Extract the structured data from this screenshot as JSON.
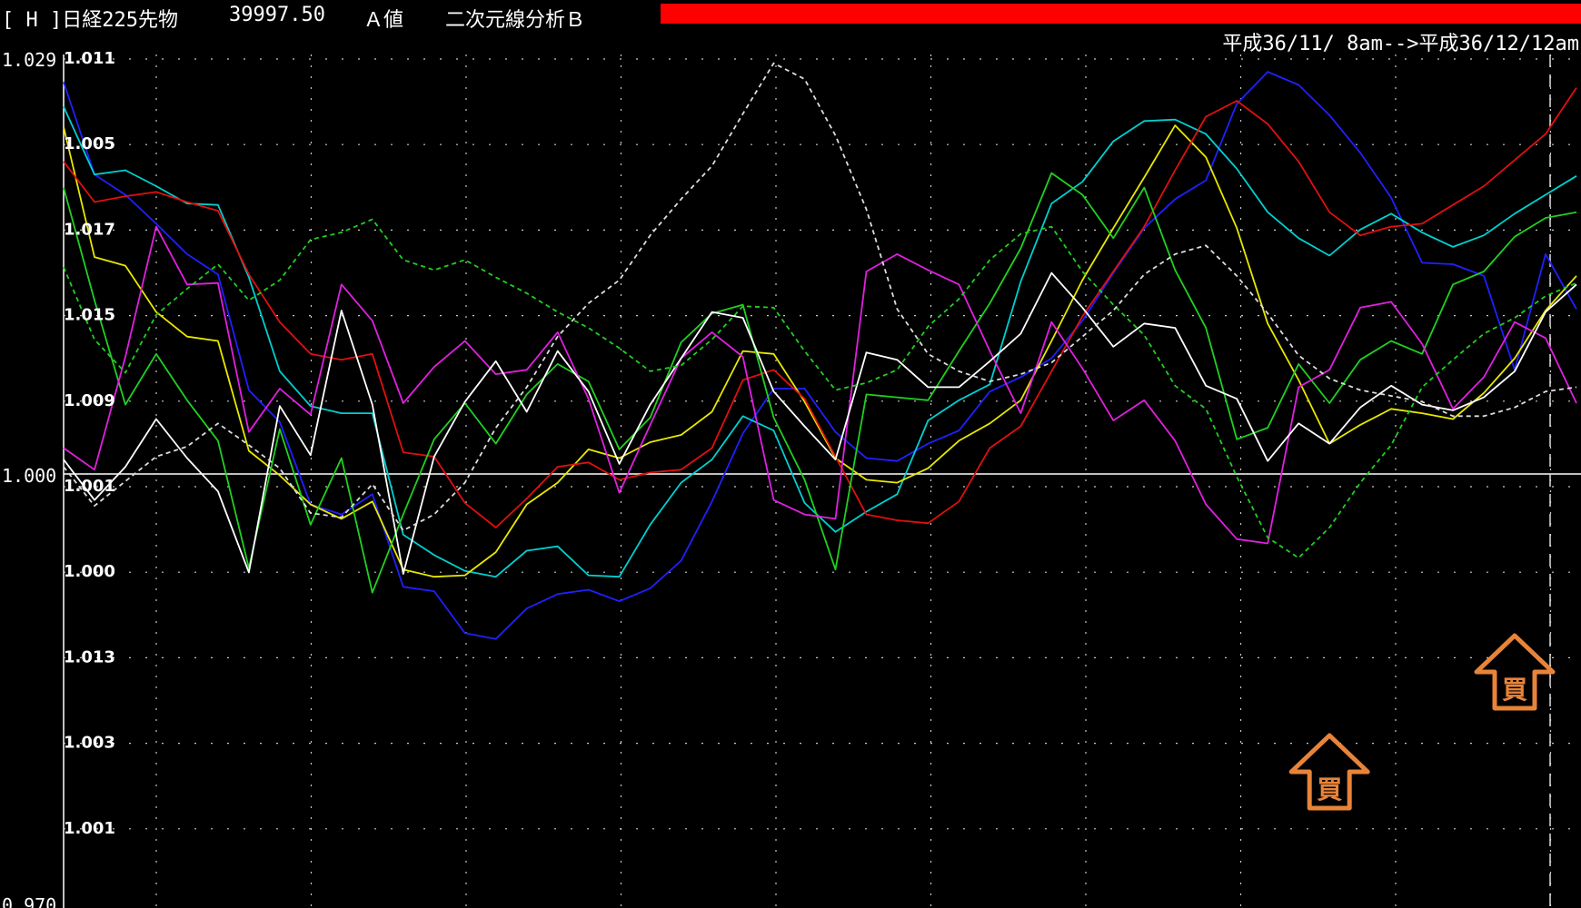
{
  "header": {
    "code": "[ H ]日経225先物",
    "price": "39997.50",
    "value_type": "Ａ値",
    "analysis": "二次元線分析Ｂ",
    "range": "平成36/11/ 8am-->平成36/12/12am",
    "bar_color": "#ff0000"
  },
  "chart_data": {
    "type": "line",
    "y_axis_labels": [
      "1.029",
      "1.000",
      "0.970"
    ],
    "ylim": [
      0.97,
      1.029
    ],
    "row_labels": [
      "1.011",
      "1.005",
      "1.017",
      "1.015",
      "1.009",
      "1.001",
      "1.000",
      "1.013",
      "1.003",
      "1.001"
    ],
    "grid": true,
    "baseline": 1.0,
    "x_count": 50,
    "series": [
      {
        "color": "#2020ff",
        "style": "solid",
        "values": [
          1.0271,
          1.0207,
          1.0193,
          1.0173,
          1.0152,
          1.0138,
          1.0058,
          1.0036,
          0.9979,
          0.9972,
          0.9986,
          0.9922,
          0.9919,
          0.989,
          0.9886,
          0.9907,
          0.9917,
          0.992,
          0.9912,
          0.9921,
          0.994,
          0.9981,
          1.0028,
          1.0059,
          1.0059,
          1.0029,
          1.0011,
          1.0009,
          1.0021,
          1.003,
          1.0057,
          1.0067,
          1.008,
          1.0106,
          1.0139,
          1.017,
          1.019,
          1.0203,
          1.0256,
          1.0278,
          1.0269,
          1.0248,
          1.0222,
          1.0191,
          1.0146,
          1.0145,
          1.0137,
          1.0072,
          1.0152,
          1.0114
        ]
      },
      {
        "color": "#00d0d0",
        "style": "solid",
        "values": [
          1.0254,
          1.0207,
          1.021,
          1.0199,
          1.0187,
          1.0186,
          1.0136,
          1.0071,
          1.0047,
          1.0042,
          1.0042,
          0.9958,
          0.9944,
          0.9933,
          0.9929,
          0.9947,
          0.995,
          0.993,
          0.9929,
          0.9965,
          0.9994,
          1.001,
          1.004,
          1.003,
          0.998,
          0.996,
          0.9974,
          0.9986,
          1.0037,
          1.0051,
          1.0062,
          1.0133,
          1.0187,
          1.0202,
          1.023,
          1.0244,
          1.0245,
          1.0235,
          1.0211,
          1.0181,
          1.0163,
          1.0151,
          1.0169,
          1.018,
          1.0167,
          1.0157,
          1.0165,
          1.018,
          1.0193,
          1.0206
        ]
      },
      {
        "color": "#e8e800",
        "style": "solid",
        "values": [
          1.024,
          1.015,
          1.0144,
          1.0112,
          1.0095,
          1.0092,
          1.0016,
          0.9999,
          0.9979,
          0.9969,
          0.9981,
          0.9934,
          0.9929,
          0.993,
          0.9946,
          0.9979,
          0.9994,
          1.0017,
          1.0011,
          1.0022,
          1.0027,
          1.0043,
          1.0085,
          1.0083,
          1.005,
          1.0011,
          0.9996,
          0.9994,
          1.0004,
          1.0023,
          1.0035,
          1.0051,
          1.0092,
          1.0134,
          1.017,
          1.0205,
          1.0241,
          1.0219,
          1.017,
          1.0104,
          1.0065,
          1.0021,
          1.0034,
          1.0045,
          1.0042,
          1.0038,
          1.0056,
          1.008,
          1.0113,
          1.0137
        ]
      },
      {
        "color": "#e01010",
        "style": "solid",
        "values": [
          1.0216,
          1.0188,
          1.0192,
          1.0195,
          1.0188,
          1.0182,
          1.0138,
          1.0105,
          1.0083,
          1.0079,
          1.0083,
          1.0015,
          1.0012,
          0.998,
          0.9963,
          0.9983,
          1.0005,
          1.0008,
          0.9996,
          1.0001,
          1.0003,
          1.0018,
          1.0065,
          1.0072,
          1.0052,
          1.0012,
          0.9972,
          0.9968,
          0.9966,
          0.9981,
          1.0018,
          1.0033,
          1.0071,
          1.0109,
          1.014,
          1.0171,
          1.021,
          1.0247,
          1.0258,
          1.0242,
          1.0216,
          1.0181,
          1.0165,
          1.0171,
          1.0173,
          1.0186,
          1.0199,
          1.0217,
          1.0235,
          1.0267
        ]
      },
      {
        "color": "#20d020",
        "style": "solid",
        "values": [
          1.0198,
          1.012,
          1.0048,
          1.0083,
          1.0051,
          1.0023,
          0.9935,
          1.0031,
          0.9965,
          1.0011,
          0.9918,
          0.9972,
          1.0024,
          1.0049,
          1.0021,
          1.0055,
          1.0076,
          1.0064,
          1.0017,
          1.0039,
          1.0091,
          1.0111,
          1.0117,
          1.0039,
          0.9996,
          0.9934,
          1.0055,
          1.0053,
          1.0051,
          1.0085,
          1.0118,
          1.0156,
          1.0208,
          1.0193,
          1.0163,
          1.0198,
          1.0141,
          1.0101,
          1.0024,
          1.0032,
          1.0076,
          1.0049,
          1.0079,
          1.0092,
          1.0083,
          1.0131,
          1.014,
          1.0164,
          1.0177,
          1.0181
        ]
      },
      {
        "color": "#e020e0",
        "style": "solid",
        "values": [
          1.0018,
          1.0003,
          1.0081,
          1.0171,
          1.0131,
          1.0132,
          1.0029,
          1.0059,
          1.0041,
          1.0131,
          1.0106,
          1.0049,
          1.0074,
          1.0092,
          1.0069,
          1.0072,
          1.0098,
          1.0052,
          0.9987,
          1.0034,
          1.008,
          1.0098,
          1.0081,
          0.9982,
          0.9972,
          0.9969,
          1.014,
          1.0152,
          1.0141,
          1.0131,
          1.0085,
          1.0042,
          1.0105,
          1.0073,
          1.0037,
          1.0051,
          1.0023,
          0.9979,
          0.9955,
          0.9952,
          1.006,
          1.0072,
          1.0115,
          1.0119,
          1.009,
          1.0045,
          1.0067,
          1.0105,
          1.0094,
          1.0049
        ]
      },
      {
        "color": "#ffffff",
        "style": "solid",
        "values": [
          1.001,
          0.9982,
          1.0005,
          1.0038,
          1.0011,
          0.9988,
          0.9932,
          1.0047,
          1.0013,
          1.0113,
          1.0048,
          0.9931,
          1.0012,
          1.005,
          1.0078,
          1.0043,
          1.0085,
          1.0057,
          1.0007,
          1.0048,
          1.008,
          1.0112,
          1.0108,
          1.0057,
          1.0033,
          1.001,
          1.0084,
          1.0079,
          1.006,
          1.006,
          1.0078,
          1.0097,
          1.0139,
          1.0115,
          1.0088,
          1.0104,
          1.0101,
          1.0061,
          1.0052,
          1.0009,
          1.0035,
          1.0021,
          1.0046,
          1.0061,
          1.0048,
          1.0044,
          1.0053,
          1.0071,
          1.0112,
          1.0131
        ]
      },
      {
        "color": "#20d020",
        "style": "dashed",
        "values": [
          1.0143,
          1.0093,
          1.007,
          1.011,
          1.0128,
          1.0145,
          1.012,
          1.0134,
          1.0162,
          1.0167,
          1.0176,
          1.0148,
          1.0141,
          1.0148,
          1.0136,
          1.0125,
          1.0112,
          1.0101,
          1.0087,
          1.0071,
          1.0075,
          1.0093,
          1.0116,
          1.0115,
          1.0085,
          1.0058,
          1.0063,
          1.0072,
          1.0102,
          1.0121,
          1.0148,
          1.0166,
          1.0171,
          1.014,
          1.0117,
          1.0096,
          1.0061,
          1.0045,
          0.9998,
          0.9956,
          0.9942,
          0.9963,
          0.9994,
          1.002,
          1.006,
          1.0079,
          1.0097,
          1.0108,
          1.0123,
          1.0132
        ]
      },
      {
        "color": "#dddddd",
        "style": "dashed",
        "values": [
          1.0005,
          0.9978,
          0.9995,
          1.0012,
          1.0019,
          1.0035,
          1.002,
          1.0004,
          0.9973,
          0.997,
          0.9993,
          0.9961,
          0.9972,
          0.9994,
          1.0032,
          1.006,
          1.0095,
          1.0118,
          1.0134,
          1.0165,
          1.019,
          1.0213,
          1.0249,
          1.0284,
          1.0273,
          1.0234,
          1.0183,
          1.0114,
          1.0083,
          1.0071,
          1.0064,
          1.0069,
          1.0077,
          1.0095,
          1.0113,
          1.0138,
          1.0152,
          1.0158,
          1.0137,
          1.0111,
          1.0082,
          1.0066,
          1.0058,
          1.0054,
          1.005,
          1.004,
          1.004,
          1.0046,
          1.0057,
          1.006
        ]
      }
    ],
    "buy_markers": [
      {
        "label": "買",
        "x_index": 41
      },
      {
        "label": "買",
        "x_index": 47
      }
    ],
    "current_marker_index": 48
  }
}
